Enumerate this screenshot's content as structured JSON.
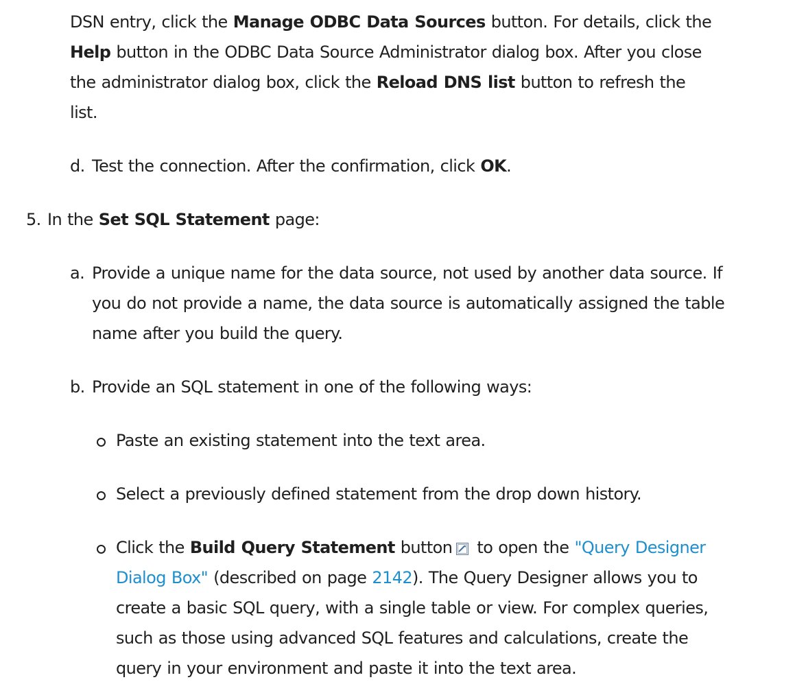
{
  "para_c": {
    "l1": {
      "t1": "DSN entry, click the ",
      "b1": "Manage ODBC Data Sources",
      "t2": " button. For details, click the"
    },
    "l2": {
      "b1": "Help",
      "t1": " button in the ODBC Data Source Administrator dialog box. After you close"
    },
    "l3": {
      "t1": "the administrator dialog box, click the ",
      "b1": "Reload DNS list",
      "t2": " button to refresh the"
    },
    "l4": {
      "t1": "list."
    }
  },
  "item_d": {
    "marker": "d.",
    "t1": "Test the connection. After the confirmation, click ",
    "b1": "OK",
    "t2": "."
  },
  "step5": {
    "marker": "5.",
    "t1": "In the ",
    "b1": "Set SQL Statement",
    "t2": " page:"
  },
  "item_a": {
    "marker": "a.",
    "l1": "Provide a unique name for the data source, not used by another data source. If",
    "l2": "you do not provide a name, the data source is automatically assigned the table",
    "l3": "name after you build the query."
  },
  "item_b": {
    "marker": "b.",
    "t1": "Provide an SQL statement in one of the following ways:"
  },
  "bullets": {
    "b1": "Paste an existing statement into the text area.",
    "b2": "Select a previously defined statement from the drop down history.",
    "b3": {
      "t1": "Click the ",
      "b1": "Build Query Statement",
      "t2": " button",
      "t3": " to open the ",
      "link": "\"Query Designer",
      "link2": "Dialog Box\"",
      "t4": " (described on page ",
      "page": "2142",
      "t5": "). The Query Designer allows you to",
      "l3": "create a basic SQL query, with a single table or view. For complex queries,",
      "l4": "such as those using advanced SQL features and calculations, create the",
      "l5": "query in your environment and paste it into the text area."
    }
  },
  "icon": "build-query-icon"
}
